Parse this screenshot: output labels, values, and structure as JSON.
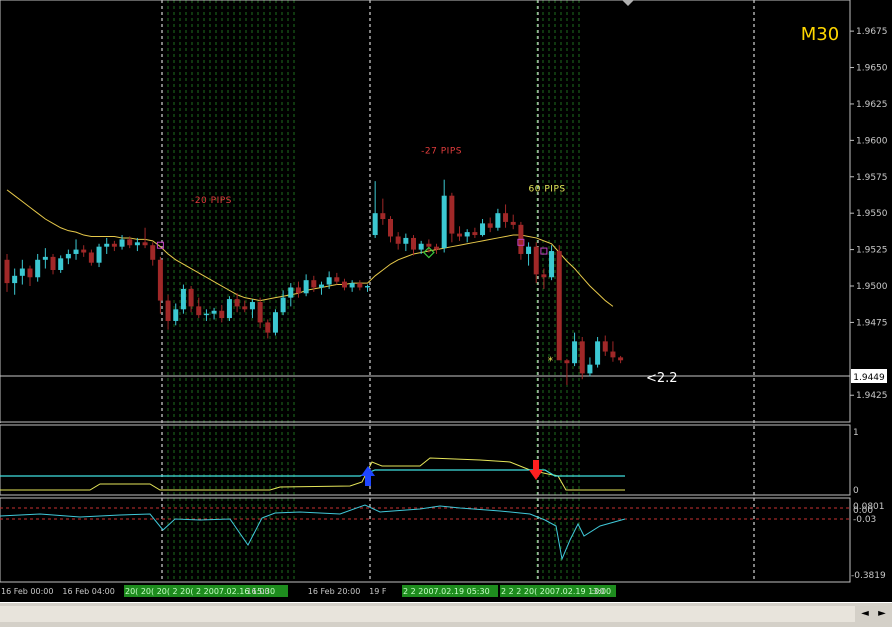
{
  "chart_data": {
    "type": "candlestick",
    "timeframe": "M30",
    "current_price": "1.9449",
    "current_label": "<2.2",
    "price_axis": [
      "1.9675",
      "1.9650",
      "1.9625",
      "1.9600",
      "1.9575",
      "1.9550",
      "1.9525",
      "1.9500",
      "1.9475",
      "1.9425"
    ],
    "ylim": [
      1.9408,
      1.9695
    ],
    "time_labels": [
      {
        "i": 0,
        "text": "16 Feb 00:00"
      },
      {
        "i": 8,
        "text": "16 Feb 04:00"
      },
      {
        "i": 32,
        "text": "16:00"
      },
      {
        "i": 40,
        "text": "16 Feb 20:00"
      },
      {
        "i": 48,
        "text": "19 F"
      },
      {
        "i": 77,
        "text": ":00"
      }
    ],
    "highlight_time_text": [
      "20( 20( 20( 2 20( 2 2007.02.16 15:30",
      "2 2 2007.02.19 05:30",
      "2 2 2 20( 2007.02.19 13:00"
    ],
    "annotations": [
      {
        "text": "-20 PIPS",
        "i": 24,
        "price": 1.9557,
        "color": "#e03c3c"
      },
      {
        "text": "-27 PIPS",
        "i": 54,
        "price": 1.9591,
        "color": "#e03c3c"
      },
      {
        "text": "60 PIPS",
        "i": 68,
        "price": 1.9565,
        "color": "#e6e65a"
      }
    ],
    "candles": [
      [
        1.9518,
        1.9522,
        1.9496,
        1.9502
      ],
      [
        1.9502,
        1.9512,
        1.9494,
        1.9507
      ],
      [
        1.9507,
        1.9518,
        1.9501,
        1.9512
      ],
      [
        1.9512,
        1.9514,
        1.95,
        1.9506
      ],
      [
        1.9506,
        1.9522,
        1.9503,
        1.9518
      ],
      [
        1.9518,
        1.9526,
        1.9512,
        1.952
      ],
      [
        1.952,
        1.9522,
        1.9508,
        1.9511
      ],
      [
        1.9511,
        1.9521,
        1.9509,
        1.9519
      ],
      [
        1.9519,
        1.9525,
        1.9515,
        1.9522
      ],
      [
        1.9522,
        1.9532,
        1.9518,
        1.9525
      ],
      [
        1.9525,
        1.9528,
        1.952,
        1.9523
      ],
      [
        1.9523,
        1.9525,
        1.9514,
        1.9516
      ],
      [
        1.9516,
        1.9529,
        1.9513,
        1.9527
      ],
      [
        1.9527,
        1.9533,
        1.9522,
        1.9529
      ],
      [
        1.9529,
        1.9531,
        1.9524,
        1.9527
      ],
      [
        1.9527,
        1.9535,
        1.9525,
        1.9532
      ],
      [
        1.9532,
        1.9534,
        1.9526,
        1.9528
      ],
      [
        1.9528,
        1.9533,
        1.9524,
        1.953
      ],
      [
        1.953,
        1.954,
        1.9526,
        1.9528
      ],
      [
        1.9528,
        1.953,
        1.9514,
        1.9518
      ],
      [
        1.9518,
        1.952,
        1.9481,
        1.949
      ],
      [
        1.949,
        1.9494,
        1.947,
        1.9476
      ],
      [
        1.9476,
        1.9488,
        1.9473,
        1.9484
      ],
      [
        1.9484,
        1.9501,
        1.9481,
        1.9498
      ],
      [
        1.9498,
        1.95,
        1.9482,
        1.9486
      ],
      [
        1.9486,
        1.9492,
        1.9478,
        1.948
      ],
      [
        1.948,
        1.9484,
        1.9476,
        1.9481
      ],
      [
        1.9481,
        1.9485,
        1.9477,
        1.9483
      ],
      [
        1.9483,
        1.9487,
        1.9475,
        1.9478
      ],
      [
        1.9478,
        1.9493,
        1.9476,
        1.9491
      ],
      [
        1.9491,
        1.9495,
        1.9482,
        1.9486
      ],
      [
        1.9486,
        1.949,
        1.9482,
        1.9484
      ],
      [
        1.9484,
        1.9491,
        1.9478,
        1.9489
      ],
      [
        1.9489,
        1.9492,
        1.9471,
        1.9475
      ],
      [
        1.9475,
        1.9477,
        1.9464,
        1.9468
      ],
      [
        1.9468,
        1.9484,
        1.9466,
        1.9482
      ],
      [
        1.9482,
        1.9497,
        1.948,
        1.9492
      ],
      [
        1.9492,
        1.9502,
        1.9486,
        1.9499
      ],
      [
        1.9499,
        1.9503,
        1.9492,
        1.9495
      ],
      [
        1.9495,
        1.9508,
        1.9493,
        1.9504
      ],
      [
        1.9504,
        1.9507,
        1.9496,
        1.9499
      ],
      [
        1.9499,
        1.9503,
        1.9494,
        1.9501
      ],
      [
        1.9501,
        1.951,
        1.9498,
        1.9506
      ],
      [
        1.9506,
        1.9509,
        1.9501,
        1.9503
      ],
      [
        1.9503,
        1.9505,
        1.9497,
        1.9499
      ],
      [
        1.9499,
        1.9504,
        1.9496,
        1.9502
      ],
      [
        1.9502,
        1.9504,
        1.9497,
        1.9499
      ],
      [
        1.9499,
        1.9501,
        1.9496,
        1.95
      ],
      [
        1.9535,
        1.9572,
        1.9533,
        1.955
      ],
      [
        1.955,
        1.956,
        1.9542,
        1.9546
      ],
      [
        1.9546,
        1.9548,
        1.953,
        1.9534
      ],
      [
        1.9534,
        1.9537,
        1.9525,
        1.9529
      ],
      [
        1.9529,
        1.9536,
        1.9524,
        1.9533
      ],
      [
        1.9533,
        1.9535,
        1.9521,
        1.9525
      ],
      [
        1.9525,
        1.9531,
        1.9522,
        1.9529
      ],
      [
        1.9529,
        1.9532,
        1.9523,
        1.9527
      ],
      [
        1.9527,
        1.9529,
        1.9522,
        1.9525
      ],
      [
        1.9526,
        1.9573,
        1.9523,
        1.9562
      ],
      [
        1.9562,
        1.9564,
        1.953,
        1.9536
      ],
      [
        1.9536,
        1.9541,
        1.9531,
        1.9534
      ],
      [
        1.9534,
        1.9539,
        1.953,
        1.9537
      ],
      [
        1.9537,
        1.954,
        1.9533,
        1.9535
      ],
      [
        1.9535,
        1.9546,
        1.9534,
        1.9543
      ],
      [
        1.9543,
        1.9547,
        1.9537,
        1.954
      ],
      [
        1.954,
        1.9553,
        1.9538,
        1.955
      ],
      [
        1.955,
        1.9556,
        1.954,
        1.9544
      ],
      [
        1.9544,
        1.9549,
        1.9539,
        1.9542
      ],
      [
        1.9542,
        1.9544,
        1.9518,
        1.9522
      ],
      [
        1.9522,
        1.953,
        1.9514,
        1.9527
      ],
      [
        1.9527,
        1.953,
        1.9502,
        1.9508
      ],
      [
        1.9508,
        1.9512,
        1.9498,
        1.9506
      ],
      [
        1.9506,
        1.9528,
        1.9504,
        1.9524
      ],
      [
        1.9524,
        1.9528,
        1.9455,
        1.9449
      ],
      [
        1.9449,
        1.945,
        1.9432,
        1.9447
      ],
      [
        1.9447,
        1.9468,
        1.9445,
        1.9462
      ],
      [
        1.9462,
        1.9465,
        1.9436,
        1.944
      ],
      [
        1.944,
        1.9451,
        1.9438,
        1.9446
      ],
      [
        1.9446,
        1.9465,
        1.9444,
        1.9462
      ],
      [
        1.9462,
        1.9466,
        1.9452,
        1.9455
      ],
      [
        1.9455,
        1.9462,
        1.9448,
        1.9451
      ],
      [
        1.9451,
        1.9452,
        1.9447,
        1.9449
      ]
    ],
    "ma": [
      1.9566,
      1.9562,
      1.9558,
      1.9554,
      1.955,
      1.9546,
      1.9543,
      1.954,
      1.9538,
      1.9537,
      1.9535,
      1.9534,
      1.9534,
      1.9534,
      1.9534,
      1.9533,
      1.9533,
      1.9532,
      1.9532,
      1.9531,
      1.9527,
      1.9522,
      1.9518,
      1.9515,
      1.9512,
      1.9509,
      1.9506,
      1.9503,
      1.95,
      1.9497,
      1.9494,
      1.9492,
      1.9491,
      1.949,
      1.9491,
      1.9492,
      1.9493,
      1.9494,
      1.9495,
      1.9497,
      1.9498,
      1.9499,
      1.95,
      1.9501,
      1.9501,
      1.9502,
      1.9502,
      1.9502,
      1.9507,
      1.9511,
      1.9515,
      1.9518,
      1.952,
      1.9522,
      1.9523,
      1.9524,
      1.9525,
      1.9526,
      1.9527,
      1.9528,
      1.9529,
      1.953,
      1.9531,
      1.9532,
      1.9533,
      1.9534,
      1.9535,
      1.9535,
      1.9534,
      1.9533,
      1.9531,
      1.9529,
      1.9523,
      1.9517,
      1.9512,
      1.9506,
      1.95,
      1.9495,
      1.949,
      1.9486
    ],
    "markers": [
      {
        "i": 20,
        "price": 1.9528,
        "shape": "square",
        "color": "#c040c0"
      },
      {
        "i": 55,
        "price": 1.9523,
        "shape": "diamond",
        "color": "#3cc83c"
      },
      {
        "i": 67,
        "price": 1.953,
        "shape": "square",
        "color": "#c040c0"
      },
      {
        "i": 70,
        "price": 1.9524,
        "shape": "square",
        "color": "#c040c0"
      },
      {
        "i": 71,
        "price": 1.9449,
        "shape": "star",
        "color": "#e6e65a"
      }
    ],
    "highlight_x_px": [
      162,
      168,
      174,
      180,
      186,
      192,
      198,
      204,
      210,
      216,
      222,
      228,
      234,
      240,
      246,
      252,
      258,
      264,
      270,
      276,
      282,
      288,
      294,
      537,
      543,
      549,
      555,
      561,
      567,
      573,
      579
    ],
    "vlines_px": [
      0,
      162,
      370,
      538,
      754
    ],
    "signal_panel": {
      "ylim_labels": [
        "1",
        "0"
      ],
      "yellow": [
        [
          0,
          490
        ],
        [
          90,
          490
        ],
        [
          100,
          484
        ],
        [
          150,
          484
        ],
        [
          160,
          490
        ],
        [
          270,
          490
        ],
        [
          280,
          487
        ],
        [
          350,
          486
        ],
        [
          362,
          482
        ],
        [
          372,
          462
        ],
        [
          382,
          466
        ],
        [
          420,
          466
        ],
        [
          430,
          458
        ],
        [
          480,
          460
        ],
        [
          510,
          462
        ],
        [
          530,
          470
        ],
        [
          548,
          474
        ],
        [
          558,
          476
        ],
        [
          566,
          490
        ],
        [
          625,
          490
        ]
      ],
      "cyan": [
        [
          0,
          476
        ],
        [
          360,
          476
        ],
        [
          375,
          470
        ],
        [
          440,
          470
        ],
        [
          530,
          470
        ],
        [
          545,
          470
        ],
        [
          555,
          476
        ],
        [
          625,
          476
        ]
      ],
      "arrows": [
        {
          "x": 368,
          "dir": "up",
          "color": "#1e46ff"
        },
        {
          "x": 536,
          "dir": "down",
          "color": "#ff2020"
        }
      ]
    },
    "osc_panel": {
      "labels": [
        "0.0801",
        "0.00",
        "-0.03",
        "-0.3819"
      ],
      "line": [
        [
          0,
          516
        ],
        [
          40,
          514
        ],
        [
          80,
          517
        ],
        [
          120,
          515
        ],
        [
          150,
          514
        ],
        [
          163,
          530
        ],
        [
          175,
          519
        ],
        [
          200,
          520
        ],
        [
          230,
          519
        ],
        [
          248,
          545
        ],
        [
          262,
          518
        ],
        [
          275,
          513
        ],
        [
          300,
          512
        ],
        [
          340,
          514
        ],
        [
          365,
          505
        ],
        [
          380,
          512
        ],
        [
          420,
          509
        ],
        [
          440,
          506
        ],
        [
          460,
          508
        ],
        [
          500,
          511
        ],
        [
          530,
          514
        ],
        [
          545,
          520
        ],
        [
          556,
          526
        ],
        [
          562,
          559
        ],
        [
          570,
          540
        ],
        [
          578,
          524
        ],
        [
          584,
          536
        ],
        [
          600,
          526
        ],
        [
          625,
          519
        ]
      ]
    }
  }
}
